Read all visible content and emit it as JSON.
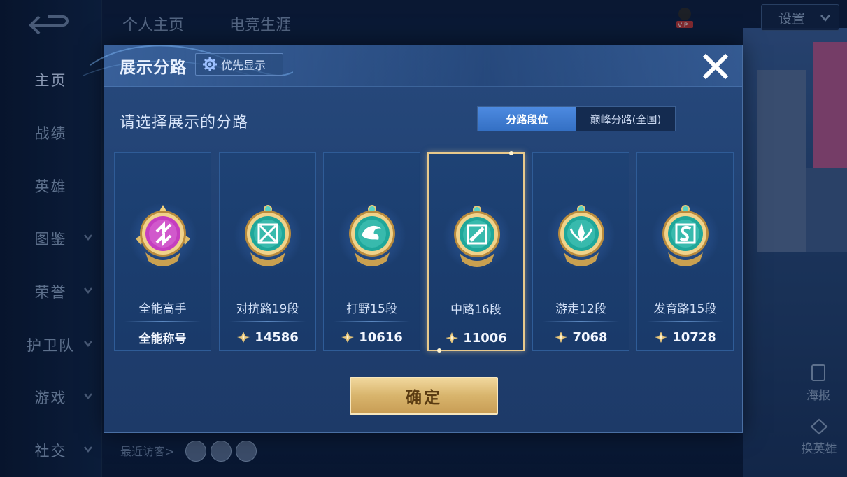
{
  "background": {
    "top_tabs": [
      "个人主页",
      "电竞生涯"
    ],
    "sidebar": [
      {
        "label": "主页",
        "active": true,
        "chevron": false
      },
      {
        "label": "战绩",
        "active": false,
        "chevron": false
      },
      {
        "label": "英雄",
        "active": false,
        "chevron": false
      },
      {
        "label": "图鉴",
        "active": false,
        "chevron": true
      },
      {
        "label": "荣誉",
        "active": false,
        "chevron": true
      },
      {
        "label": "护卫队",
        "active": false,
        "chevron": true
      },
      {
        "label": "游戏",
        "active": false,
        "chevron": true
      },
      {
        "label": "社交",
        "active": false,
        "chevron": true
      }
    ],
    "settings_label": "设置",
    "vip_label": "VIP",
    "poster_label": "海报",
    "switch_hero_label": "换英雄",
    "recent_visitors_label": "最近访客>"
  },
  "modal": {
    "title": "展示分路",
    "priority_label": "优先显示",
    "subtitle": "请选择展示的分路",
    "tabs": [
      {
        "label": "分路段位",
        "active": true
      },
      {
        "label": "巅峰分路(全国)",
        "active": false
      }
    ],
    "cards": [
      {
        "label": "全能高手",
        "footer": "全能称号",
        "has_score": false,
        "selected": false,
        "emblem": "all-round-emblem-icon"
      },
      {
        "label": "对抗路19段",
        "footer": "14586",
        "has_score": true,
        "selected": false,
        "emblem": "clash-lane-emblem-icon"
      },
      {
        "label": "打野15段",
        "footer": "10616",
        "has_score": true,
        "selected": false,
        "emblem": "jungle-emblem-icon"
      },
      {
        "label": "中路16段",
        "footer": "11006",
        "has_score": true,
        "selected": true,
        "emblem": "mid-lane-emblem-icon"
      },
      {
        "label": "游走12段",
        "footer": "7068",
        "has_score": true,
        "selected": false,
        "emblem": "roam-emblem-icon"
      },
      {
        "label": "发育路15段",
        "footer": "10728",
        "has_score": true,
        "selected": false,
        "emblem": "farm-lane-emblem-icon"
      }
    ],
    "confirm_label": "确定"
  },
  "colors": {
    "accent_blue": "#3470c4",
    "gold": "#d8b46c",
    "emblem_teal": "#1fa79a",
    "emblem_magenta": "#c53ec0"
  }
}
